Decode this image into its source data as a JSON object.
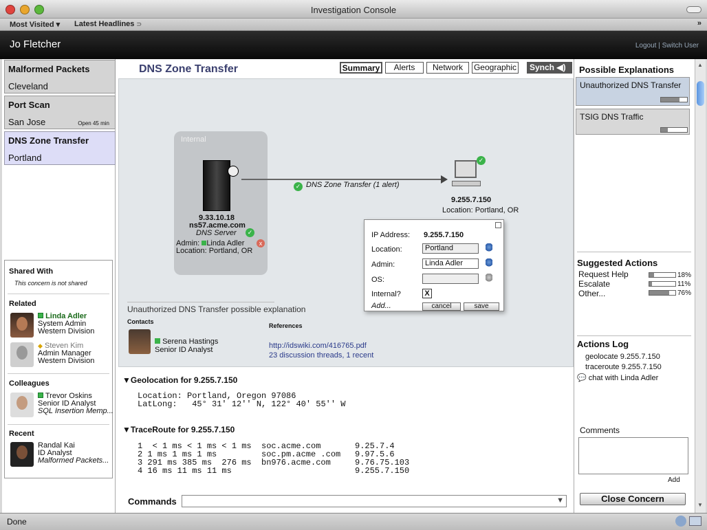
{
  "window": {
    "title": "Investigation Console"
  },
  "bookmarks": {
    "most_visited": "Most Visited ▾",
    "latest_headlines": "Latest Headlines"
  },
  "header": {
    "user": "Jo Fletcher",
    "logout": "Logout",
    "sep": "|",
    "switch_user": "Switch User"
  },
  "cases": [
    {
      "name": "Malformed Packets",
      "city": "Cleveland",
      "note": ""
    },
    {
      "name": "Port Scan",
      "city": "San Jose",
      "note": "Open 45 min"
    },
    {
      "name": "DNS Zone Transfer",
      "city": "Portland",
      "note": ""
    }
  ],
  "social": {
    "shared_title": "Shared With",
    "shared_text": "This concern is not shared",
    "related_title": "Related",
    "related": [
      {
        "name": "Linda Adler",
        "role": "System Admin",
        "dept": "Western Division"
      },
      {
        "name": "Steven Kim",
        "role": "Admin Manager",
        "dept": "Western Division"
      }
    ],
    "colleagues_title": "Colleagues",
    "colleague": {
      "name": "Trevor Oskins",
      "role": "Senior ID Analyst",
      "dept": "SQL Insertion Memp..."
    },
    "recent_title": "Recent",
    "recent": {
      "name": "Randal Kai",
      "role": "ID Analyst",
      "dept": "Malformed Packets..."
    }
  },
  "main": {
    "title": "DNS Zone Transfer",
    "tabs": [
      "Summary",
      "Alerts",
      "Network",
      "Geographic"
    ],
    "synch": "Synch",
    "internal_label": "Internal",
    "server": {
      "ip": "9.33.10.18",
      "host": "ns57.acme.com",
      "role": "DNS Server",
      "admin_label": "Admin:",
      "admin": "Linda Adler",
      "location": "Location: Portland, OR"
    },
    "edge_label": "DNS Zone Transfer (1 alert)",
    "target": {
      "ip": "9.255.7.150",
      "location": "Location: Portland, OR"
    },
    "popup": {
      "ip_label": "IP Address:",
      "ip": "9.255.7.150",
      "location_label": "Location:",
      "location": "Portland",
      "admin_label": "Admin:",
      "admin": "Linda Adler",
      "os_label": "OS:",
      "os": "",
      "internal_label": "Internal?",
      "internal_value": "X",
      "add": "Add...",
      "cancel": "cancel",
      "save": "save"
    },
    "explanation": "Unauthorized DNS Transfer possible explanation",
    "contacts_title": "Contacts",
    "contact": {
      "name": "Serena Hastings",
      "role": "Senior ID Analyst"
    },
    "references_title": "References",
    "references": [
      "http://idswiki.com/416765.pdf",
      "23 discussion threads, 1 recent"
    ],
    "geo_title": "Geolocation for 9.255.7.150",
    "geo_lines": [
      "Location: Portland, Oregon 97086",
      "LatLong:   45° 31' 12'' N, 122° 40' 55'' W"
    ],
    "trace_title": "TraceRoute for 9.255.7.150",
    "trace": [
      [
        "1  < 1 ms < 1 ms < 1 ms",
        "soc.acme.com",
        "9.25.7.4"
      ],
      [
        "2 1 ms 1 ms 1 ms",
        "soc.pm.acme .com",
        "9.97.5.6"
      ],
      [
        "3 291 ms 385 ms  276 ms",
        "bn976.acme.com",
        "9.76.75.103"
      ],
      [
        "4 16 ms 11 ms 11 ms",
        "",
        "9.255.7.150"
      ]
    ],
    "commands_label": "Commands"
  },
  "right": {
    "explanations_title": "Possible Explanations",
    "explanations": [
      {
        "label": "Unauthorized DNS Transfer",
        "level": 0.7
      },
      {
        "label": "TSIG DNS Traffic",
        "level": 0.25
      }
    ],
    "suggested_title": "Suggested Actions",
    "suggested": [
      {
        "label": "Request Help",
        "pct": "18%",
        "value": 0.18
      },
      {
        "label": "Escalate",
        "pct": "11%",
        "value": 0.11
      },
      {
        "label": "Other...",
        "pct": "76%",
        "value": 0.76
      }
    ],
    "log_title": "Actions Log",
    "log": [
      "geolocate 9.255.7.150",
      "traceroute 9.255.7.150",
      "chat with Linda Adler"
    ],
    "comments_title": "Comments",
    "add": "Add",
    "close": "Close Concern"
  },
  "status": {
    "text": "Done"
  },
  "colors": {
    "accent": "#3a3f6e",
    "selected": "#ddddf7",
    "header": "#0a0a0a",
    "green": "#3bb34a"
  }
}
